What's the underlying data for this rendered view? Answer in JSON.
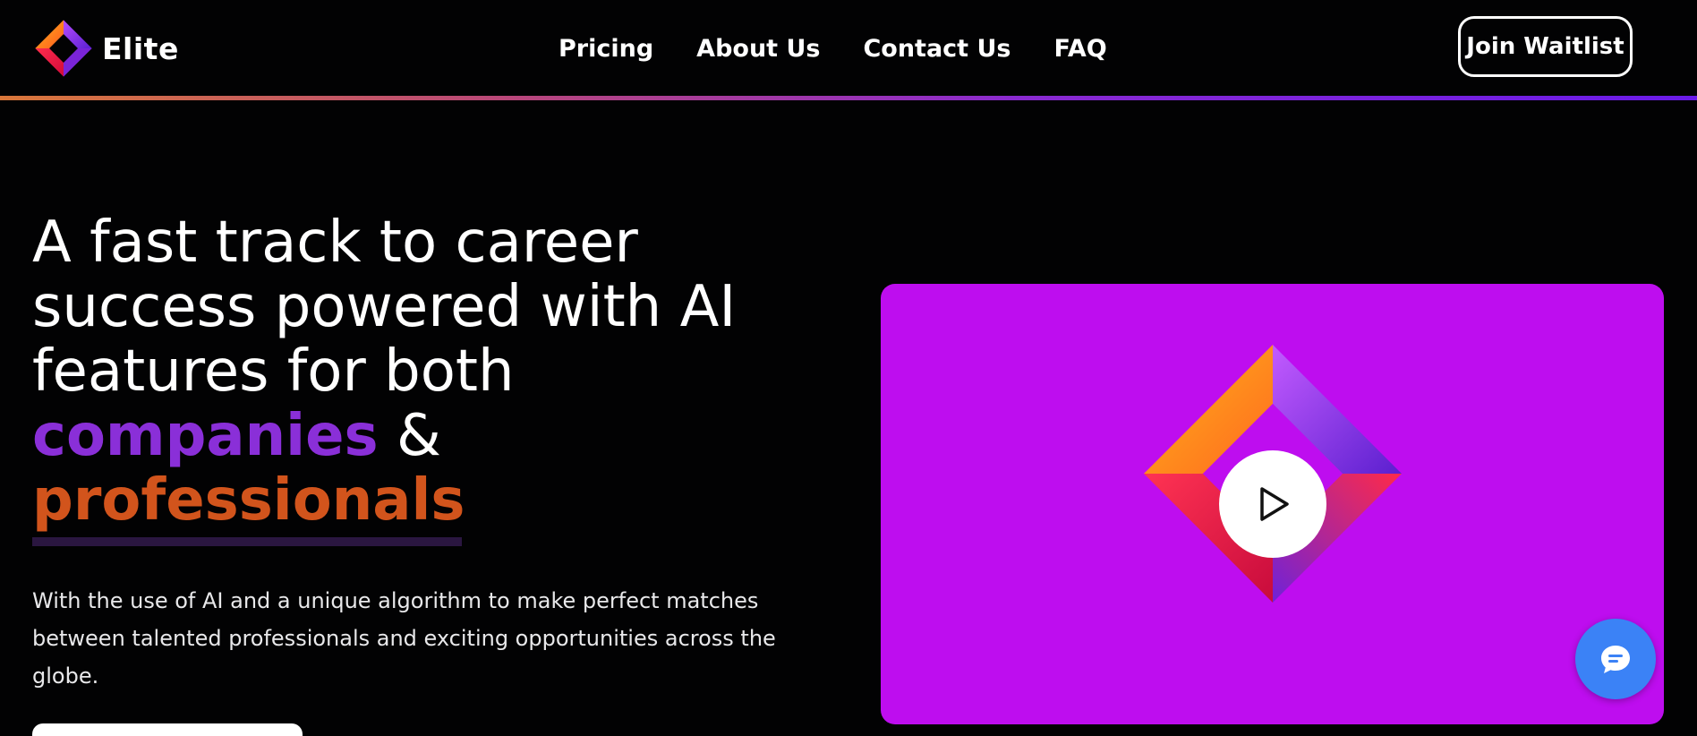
{
  "brand": {
    "name": "Elite",
    "logo_icon": "diamond-logo-icon"
  },
  "nav": {
    "items": [
      {
        "label": "Pricing"
      },
      {
        "label": "About Us"
      },
      {
        "label": "Contact Us"
      },
      {
        "label": "FAQ"
      }
    ],
    "waitlist_label": "Join Waitlist"
  },
  "hero": {
    "title_line1": "A fast track to career",
    "title_line2": "success powered with AI",
    "title_line3": "features for both",
    "title_highlight_companies": "companies",
    "title_ampersand": " &",
    "title_highlight_professionals": "professionals",
    "description": "With the use of AI and a unique algorithm to make perfect matches between talented professionals and exciting opportunities across the globe."
  },
  "video": {
    "play_icon": "play-icon",
    "logo_icon": "diamond-logo-icon"
  },
  "chat": {
    "icon": "chat-bubble-icon"
  },
  "colors": {
    "background": "#020203",
    "purple_highlight": "#8a2fd8",
    "orange_highlight": "#d2541c",
    "video_panel": "#be0def",
    "chat_button": "#3b82f6"
  }
}
